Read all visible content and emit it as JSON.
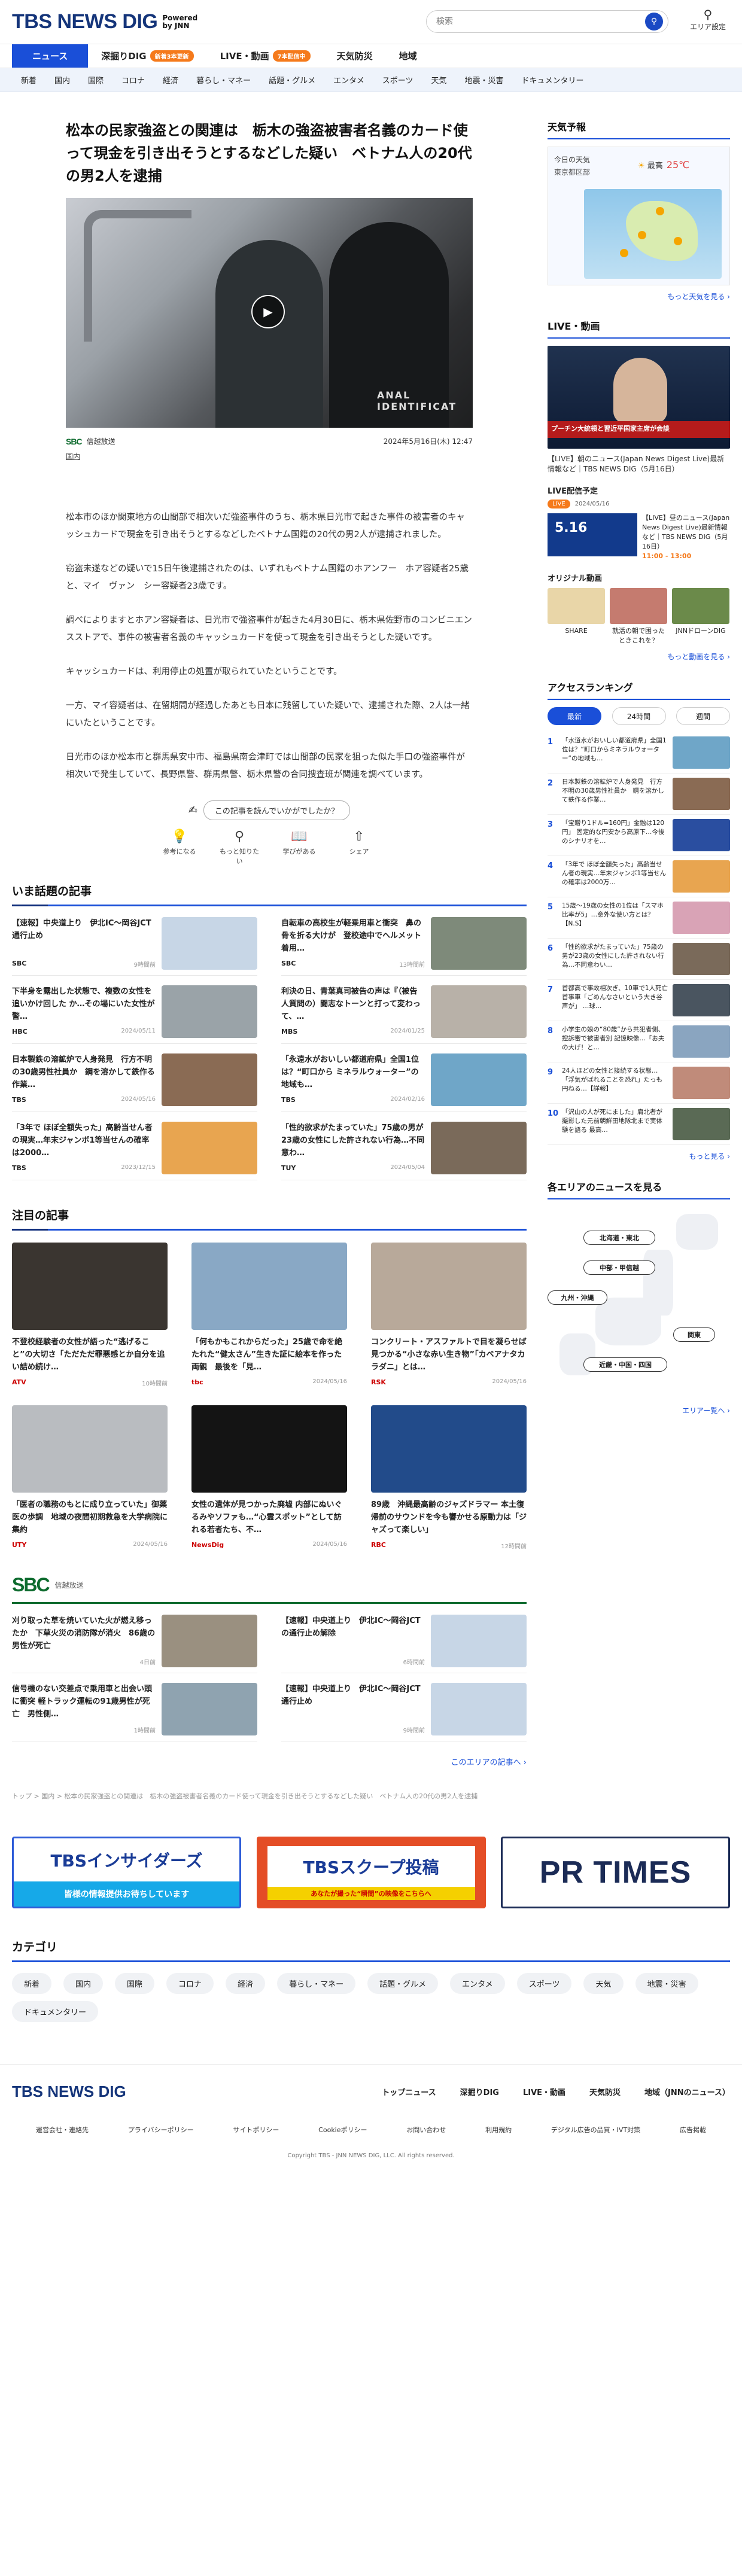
{
  "header": {
    "logo": "TBS NEWS DIG",
    "powered": "Powered\nby JNN",
    "search_placeholder": "検索",
    "area_label": "エリア設定"
  },
  "mainnav": [
    {
      "label": "ニュース",
      "badge": ""
    },
    {
      "label": "深掘りDIG",
      "badge": "新着3本更新"
    },
    {
      "label": "LIVE・動画",
      "badge": "7本配信中"
    },
    {
      "label": "天気防災",
      "badge": ""
    },
    {
      "label": "地域",
      "badge": ""
    }
  ],
  "subnav": [
    "新着",
    "国内",
    "国際",
    "コロナ",
    "経済",
    "暮らし・マネー",
    "話題・グルメ",
    "エンタメ",
    "スポーツ",
    "天気",
    "地震・災害",
    "ドキュメンタリー"
  ],
  "article": {
    "title": "松本の民家強盗との関連は　栃木の強盗被害者名義のカード使って現金を引き出そうとするなどした疑い　ベトナム人の20代の男2人を逮捕",
    "source": "信越放送",
    "date": "2024年5月16日(木) 12:47",
    "category": "国内",
    "hero_text": "ANAL IDENTIFICAT",
    "paragraphs": [
      "松本市のほか関東地方の山間部で相次いだ強盗事件のうち、栃木県日光市で起きた事件の被害者のキャッシュカードで現金を引き出そうとするなどしたベトナム国籍の20代の男2人が逮捕されました。",
      "窃盗未遂などの疑いで15日午後逮捕されたのは、いずれもベトナム国籍のホアンフー　ホア容疑者25歳と、マイ　ヴァン　シー容疑者23歳です。",
      "調べによりますとホアン容疑者は、日光市で強盗事件が起きた4月30日に、栃木県佐野市のコンビニエンスストアで、事件の被害者名義のキャッシュカードを使って現金を引き出そうとした疑いです。",
      "キャッシュカードは、利用停止の処置が取られていたということです。",
      "一方、マイ容疑者は、在留期間が経過したあとも日本に残留していた疑いで、逮捕された際、2人は一緒にいたということです。",
      "日光市のほか松本市と群馬県安中市、福島県南会津町では山間部の民家を狙った似た手口の強盗事件が相次いで発生していて、長野県警、群馬県警、栃木県警の合同捜査班が関連を調べています。"
    ]
  },
  "feedback": {
    "question": "この記事を読んでいかがでしたか？",
    "buttons": [
      "参考になる",
      "もっと知りたい",
      "学びがある",
      "シェア"
    ]
  },
  "trending": {
    "heading": "いま話題の記事",
    "items": [
      {
        "headline": "【速報】中央道上り　伊北IC～岡谷JCT　通行止め",
        "broadcaster": "SBC",
        "time": "9時間前",
        "color": "#c7d6e6"
      },
      {
        "headline": "自転車の高校生が軽乗用車と衝突　鼻の骨を折る大けが　登校途中でヘルメット着用…",
        "broadcaster": "SBC",
        "time": "13時間前",
        "color": "#7e8a7a"
      },
      {
        "headline": "下半身を露出した状態で、複数の女性を追いかけ回した か…その場にいた女性が警…",
        "broadcaster": "HBC",
        "time": "2024/05/11",
        "color": "#9aa3a8"
      },
      {
        "headline": "利決の日、青葉真司被告の声は『（被告人質問の）闘志なトーンと打って変わって、…",
        "broadcaster": "MBS",
        "time": "2024/01/25",
        "color": "#b8b1a8"
      },
      {
        "headline": "日本製鉄の溶鉱炉で人身発見　行方不明の30歳男性社員か　鋼を溶かして鉄作る作業…",
        "broadcaster": "TBS",
        "time": "2024/05/16",
        "color": "#8a6b54"
      },
      {
        "headline": "「永遠水がおいしい都道府県」全国1位は？“町口から ミネラルウォーター”の地域も…",
        "broadcaster": "TBS",
        "time": "2024/02/16",
        "color": "#6fa6c8"
      },
      {
        "headline": "「3年で ほぼ全額失った」高齢当せん者の現実…年末ジャンボ1等当せんの確率は2000…",
        "broadcaster": "TBS",
        "time": "2023/12/15",
        "color": "#e8a550"
      },
      {
        "headline": "「性的欲求がたまっていた」75歳の男が23歳の女性にした許されない行為…不同意わ…",
        "broadcaster": "TUY",
        "time": "2024/05/04",
        "color": "#7a6a5a"
      }
    ]
  },
  "featured": {
    "heading": "注目の記事",
    "items": [
      {
        "headline": "不登校経験者の女性が語った“逃げること”の大切さ「ただただ罪悪感とか自分を追い詰め続け…",
        "broadcaster": "ATV",
        "time": "10時間前",
        "color": "#3a3530"
      },
      {
        "headline": "「何もかもこれからだった」25歳で命を絶たれた“健太さん”生きた証に絵本を作った両親　最後を「見…",
        "broadcaster": "tbc",
        "time": "2024/05/16",
        "color": "#89a8c5"
      },
      {
        "headline": "コンクリート・アスファルトで目を凝らせば見つかる“小さな赤い生き物”「カベアナタカラダニ」とは…",
        "broadcaster": "RSK",
        "time": "2024/05/16",
        "color": "#b8a99a"
      },
      {
        "headline": "「医者の職務のもとに成り立っていた」御薬医の歩調　地域の夜間初期救急を大学病院に集約",
        "broadcaster": "UTY",
        "time": "2024/05/16",
        "color": "#b9bcc0"
      },
      {
        "headline": "女性の遺体が見つかった廃墟 内部にぬいぐるみやソファも…“心霊スポット”として訪れる若者たち、不…",
        "broadcaster": "NewsDig",
        "time": "2024/05/16",
        "color": "#141414"
      },
      {
        "headline": "89歳　沖縄最高齢のジャズドラマー 本土復帰前のサウンドを今も響かせる原動力は「ジャズって楽しい」",
        "broadcaster": "RBC",
        "time": "12時間前",
        "color": "#224b8a"
      }
    ]
  },
  "local": {
    "logo": "SBC",
    "name": "信越放送",
    "items": [
      {
        "headline": "刈り取った草を焼いていた火が燃え移ったか　下草火災の消防隊が消火　86歳の男性が死亡",
        "time": "4日前",
        "color": "#9a9080"
      },
      {
        "headline": "【速報】中央道上り　伊北IC～岡谷JCTの通行止め解除",
        "time": "6時間前",
        "color": "#c7d6e6"
      },
      {
        "headline": "信号機のない交差点で乗用車と出会い頭に衝突 軽トラック運転の91歳男性が死亡　男性側…",
        "time": "1時間前",
        "color": "#8fa3b0"
      },
      {
        "headline": "【速報】中央道上り　伊北IC～岡谷JCT　通行止め",
        "time": "9時間前",
        "color": "#c7d6e6"
      }
    ],
    "more": "このエリアの記事へ ›"
  },
  "breadcrumb": "トップ > 国内 > 松本の民家強盗との関連は　栃木の強盗被害者名義のカード使って現金を引き出そうとするなどした疑い　ベトナム人の20代の男2人を逮捕",
  "sidebar": {
    "weather_heading": "天気予報",
    "weather_today": "今日の天気",
    "weather_region": "東京都区部",
    "weather_hi": "25℃",
    "weather_hi_label": "最高",
    "weather_more": "もっと天気を見る ›",
    "live_heading": "LIVE・動画",
    "live_caption": "【LIVE】朝のニュース(Japan News Digest Live)最新情報など｜TBS NEWS DIG（5月16日）",
    "live_band": "プーチン大統領と習近平国家主席が会談",
    "sched_heading": "LIVE配信予定",
    "sched_now": "LIVE",
    "sched_date": "2024/05/16",
    "sched_title": "【LIVE】昼のニュース(Japan News Digest Live)最新情報など｜TBS NEWS DIG（5月16日）",
    "sched_time": "11:00 - 13:00",
    "sched_thumb": "5.16",
    "orig_heading": "オリジナル動画",
    "orig": [
      {
        "t": "SHARE",
        "color": "#e9d6a8"
      },
      {
        "t": "就活の朝で困ったときこれを？",
        "color": "#c57b6f"
      },
      {
        "t": "JNNドローンDIG",
        "color": "#6b8a4a"
      }
    ],
    "video_more": "もっと動画を見る ›",
    "ranking_heading": "アクセスランキング",
    "ranking_tabs": [
      "最新",
      "24時間",
      "週間"
    ],
    "ranking": [
      {
        "t": "「水道水がおいしい都道府県」全国1位は？“町口からミネラルウォーター”の地域も…",
        "color": "#6fa6c8"
      },
      {
        "t": "日本製鉄の溶鉱炉で人身発見　行方不明の30歳男性社員か　鋼を溶かして鉄作る作業…",
        "color": "#8a6b54"
      },
      {
        "t": "「宝贈り1ドル=160円」金融は120円」 固定的な円安から高原下…今後のシナリオを…",
        "color": "#2a4ea0"
      },
      {
        "t": "「3年で ほぼ全額失った」高齢当せん者の現実…年末ジャンボ1等当せんの確率は2000万…",
        "color": "#e8a550"
      },
      {
        "t": "15歳〜19歳の女性の1位は「スマホ比率が5」…意外な使い方とは？【N.S】",
        "color": "#d9a3b6"
      },
      {
        "t": "「性的欲求がたまっていた」75歳の男が23歳の女性にした許されない行為…不同意わい…",
        "color": "#7a6a5a"
      },
      {
        "t": "首都高で事故相次ぎ、10車で1人死亡 首事車「ごめんなさいという大き谷声が」 …球…",
        "color": "#4a5560"
      },
      {
        "t": "小学生の娘の“80歳”から共犯者側、控訴審で被害者別 記憶映像…「お夫の大げ！と…",
        "color": "#8aa5c0"
      },
      {
        "t": "24人ほどの女性と接続する状態…「浮気がばれることを恐れ」たっも円ねる…【詳報】",
        "color": "#c08b7a"
      },
      {
        "t": "「沢山の人が死にました」肩北者が撮影した元前朝鮮田地隊北まで実体験を語る 最高…",
        "color": "#5a6a55"
      }
    ],
    "ranking_more": "もっと見る ›",
    "area_heading": "各エリアのニュースを見る",
    "areas": [
      "北海道・東北",
      "中部・甲信越",
      "九州・沖縄",
      "関東",
      "近畿・中国・四国"
    ],
    "area_more": "エリアー覧へ ›"
  },
  "banners": {
    "insiders": "TBSインサイダーズ",
    "insiders_sub": "皆様の情報提供お待ちしています",
    "scoop": "TBSスクープ投稿",
    "scoop_sub": "あなたが撮った“瞬間”の映像をこちらへ",
    "prtimes": "PR TIMES"
  },
  "categories": {
    "heading": "カテゴリ",
    "items": [
      "新着",
      "国内",
      "国際",
      "コロナ",
      "経済",
      "暮らし・マネー",
      "話題・グルメ",
      "エンタメ",
      "スポーツ",
      "天気",
      "地震・災害",
      "ドキュメンタリー"
    ]
  },
  "footer": {
    "logo": "TBS NEWS DIG",
    "nav": [
      "トップニュース",
      "深掘りDIG",
      "LIVE・動画",
      "天気防災",
      "地域（JNNのニュース）"
    ],
    "links": [
      "運営会社・連絡先",
      "プライバシーポリシー",
      "サイトポリシー",
      "Cookieポリシー",
      "お問い合わせ",
      "利用規約",
      "デジタル広告の品質・IVT対策",
      "広告掲載"
    ],
    "copyright": "Copyright TBS - JNN NEWS DIG, LLC. All rights reserved."
  }
}
